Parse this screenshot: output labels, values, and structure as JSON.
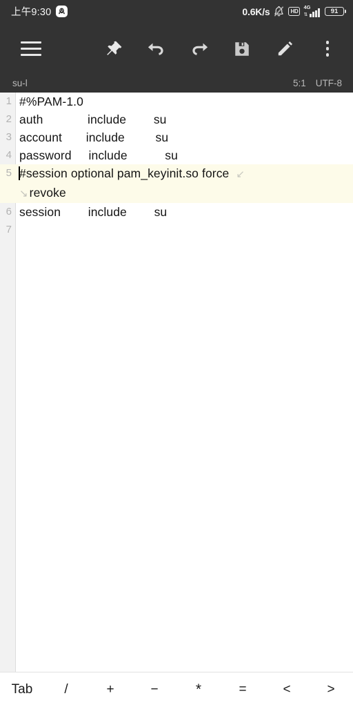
{
  "status_bar": {
    "clock": "上午9:30",
    "notification_icon": "qq-penguin-icon",
    "network_speed": "0.6K/s",
    "mute_icon": "bell-muted-icon",
    "hd_badge": "HD",
    "network_type": "4G",
    "signal_icon": "signal-bars-icon",
    "battery_level": "91",
    "colors": {
      "background": "#333333",
      "text": "#f2f2f2"
    }
  },
  "toolbar": {
    "menu_label": "menu",
    "pin_label": "pin",
    "undo_label": "undo",
    "redo_label": "redo",
    "save_label": "save",
    "edit_label": "edit",
    "overflow_label": "more options",
    "colors": {
      "background": "#333333",
      "icon": "#e4e4e4"
    }
  },
  "info_bar": {
    "filename": "su-l",
    "cursor_position": "5:1",
    "encoding": "UTF-8",
    "colors": {
      "background": "#333333",
      "text": "#b9b9b9"
    }
  },
  "editor": {
    "highlight_color": "#fdfbe9",
    "gutter_color": "#f2f2f2",
    "wrap_end_marker": "↙",
    "wrap_continue_marker": "↘",
    "lines": [
      {
        "number": "1",
        "text": "#%PAM-1.0",
        "highlighted": false,
        "wrapped": false
      },
      {
        "number": "2",
        "text": "auth             include        su",
        "highlighted": false,
        "wrapped": false
      },
      {
        "number": "3",
        "text": "account       include         su",
        "highlighted": false,
        "wrapped": false
      },
      {
        "number": "4",
        "text": "password     include           su",
        "highlighted": false,
        "wrapped": false
      },
      {
        "number": "5",
        "text": "#session            optional      pam_keyinit.so  force",
        "wrap_tail": "revoke",
        "highlighted": true,
        "wrapped": true,
        "has_caret": true
      },
      {
        "number": "6",
        "text": "session        include        su",
        "highlighted": false,
        "wrapped": false
      },
      {
        "number": "7",
        "text": "",
        "highlighted": false,
        "wrapped": false
      }
    ]
  },
  "symbol_bar": {
    "keys": [
      {
        "label": "Tab",
        "name": "tab-key"
      },
      {
        "label": "/",
        "name": "slash-key"
      },
      {
        "label": "+",
        "name": "plus-key"
      },
      {
        "label": "−",
        "name": "minus-key"
      },
      {
        "label": "*",
        "name": "asterisk-key"
      },
      {
        "label": "=",
        "name": "equals-key"
      },
      {
        "label": "<",
        "name": "less-than-key"
      },
      {
        "label": ">",
        "name": "greater-than-key"
      }
    ]
  }
}
